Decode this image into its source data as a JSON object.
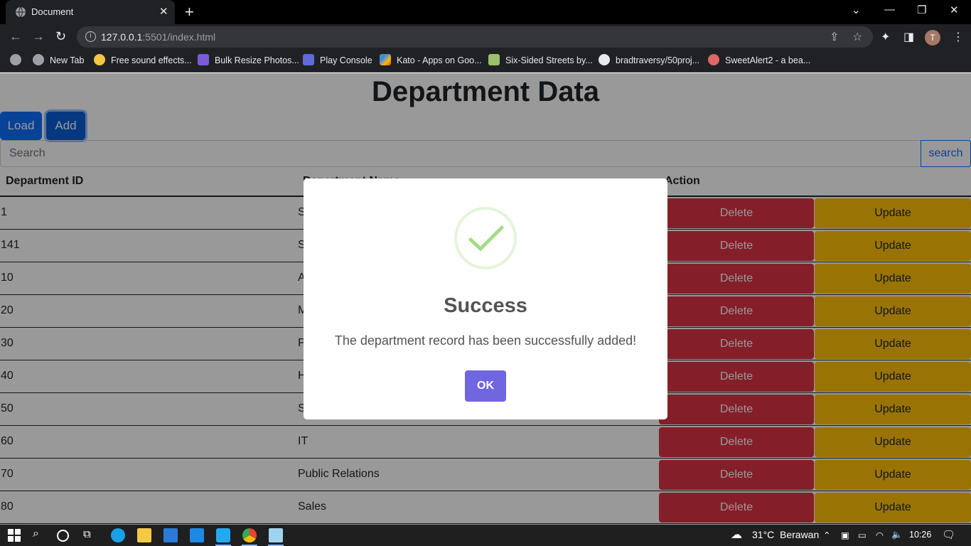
{
  "browser": {
    "tab_title": "Document",
    "url_host": "127.0.0.1",
    "url_rest": ":5501/index.html",
    "bookmarks": [
      "New Tab",
      "Free sound effects...",
      "Bulk Resize Photos...",
      "Play Console",
      "Kato - Apps on Goo...",
      "Six-Sided Streets by...",
      "bradtraversy/50proj...",
      "SweetAlert2 - a bea..."
    ],
    "avatar_initial": "T"
  },
  "page": {
    "title": "Department Data",
    "load_label": "Load",
    "add_label": "Add",
    "search_placeholder": "Search",
    "search_button": "search",
    "headers": {
      "id": "Department ID",
      "name": "Department Name",
      "action": "Action"
    },
    "delete_label": "Delete",
    "update_label": "Update",
    "rows": [
      {
        "id": "1",
        "name": "S"
      },
      {
        "id": "141",
        "name": "S"
      },
      {
        "id": "10",
        "name": "A"
      },
      {
        "id": "20",
        "name": "M"
      },
      {
        "id": "30",
        "name": "P"
      },
      {
        "id": "40",
        "name": "H"
      },
      {
        "id": "50",
        "name": "S"
      },
      {
        "id": "60",
        "name": "IT"
      },
      {
        "id": "70",
        "name": "Public Relations"
      },
      {
        "id": "80",
        "name": "Sales"
      }
    ]
  },
  "modal": {
    "title": "Success",
    "text": "The department record has been successfully added!",
    "ok_label": "OK",
    "icon": "check-icon"
  },
  "taskbar": {
    "weather": "31°C",
    "weather_text": "Berawan",
    "time": "10:26"
  },
  "colors": {
    "primary": "#0d6efd",
    "danger": "#dc3545",
    "warning": "#ffc107",
    "swal_confirm": "#7066e0",
    "success_check": "#a5dc86"
  }
}
